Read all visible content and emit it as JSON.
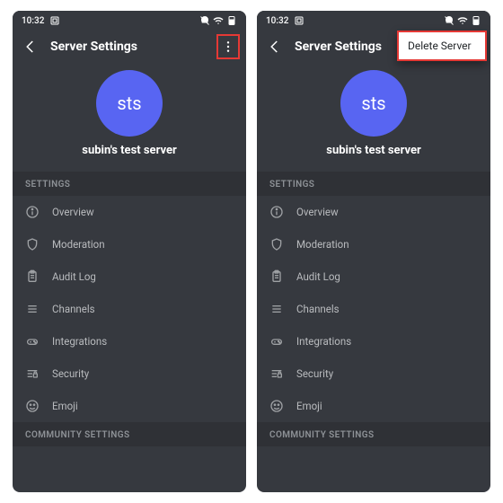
{
  "statusbar": {
    "time": "10:32"
  },
  "header": {
    "title": "Server Settings"
  },
  "server": {
    "initials": "sts",
    "name": "subin's test server",
    "avatar_color": "#5865F2"
  },
  "sections": {
    "settings_label": "SETTINGS",
    "community_label": "COMMUNITY SETTINGS"
  },
  "settings_items": [
    {
      "icon": "info",
      "label": "Overview"
    },
    {
      "icon": "shield",
      "label": "Moderation"
    },
    {
      "icon": "clipboard",
      "label": "Audit Log"
    },
    {
      "icon": "lines",
      "label": "Channels"
    },
    {
      "icon": "controller",
      "label": "Integrations"
    },
    {
      "icon": "lock-lines",
      "label": "Security"
    },
    {
      "icon": "emoji",
      "label": "Emoji"
    }
  ],
  "popup": {
    "delete_label": "Delete Server"
  }
}
